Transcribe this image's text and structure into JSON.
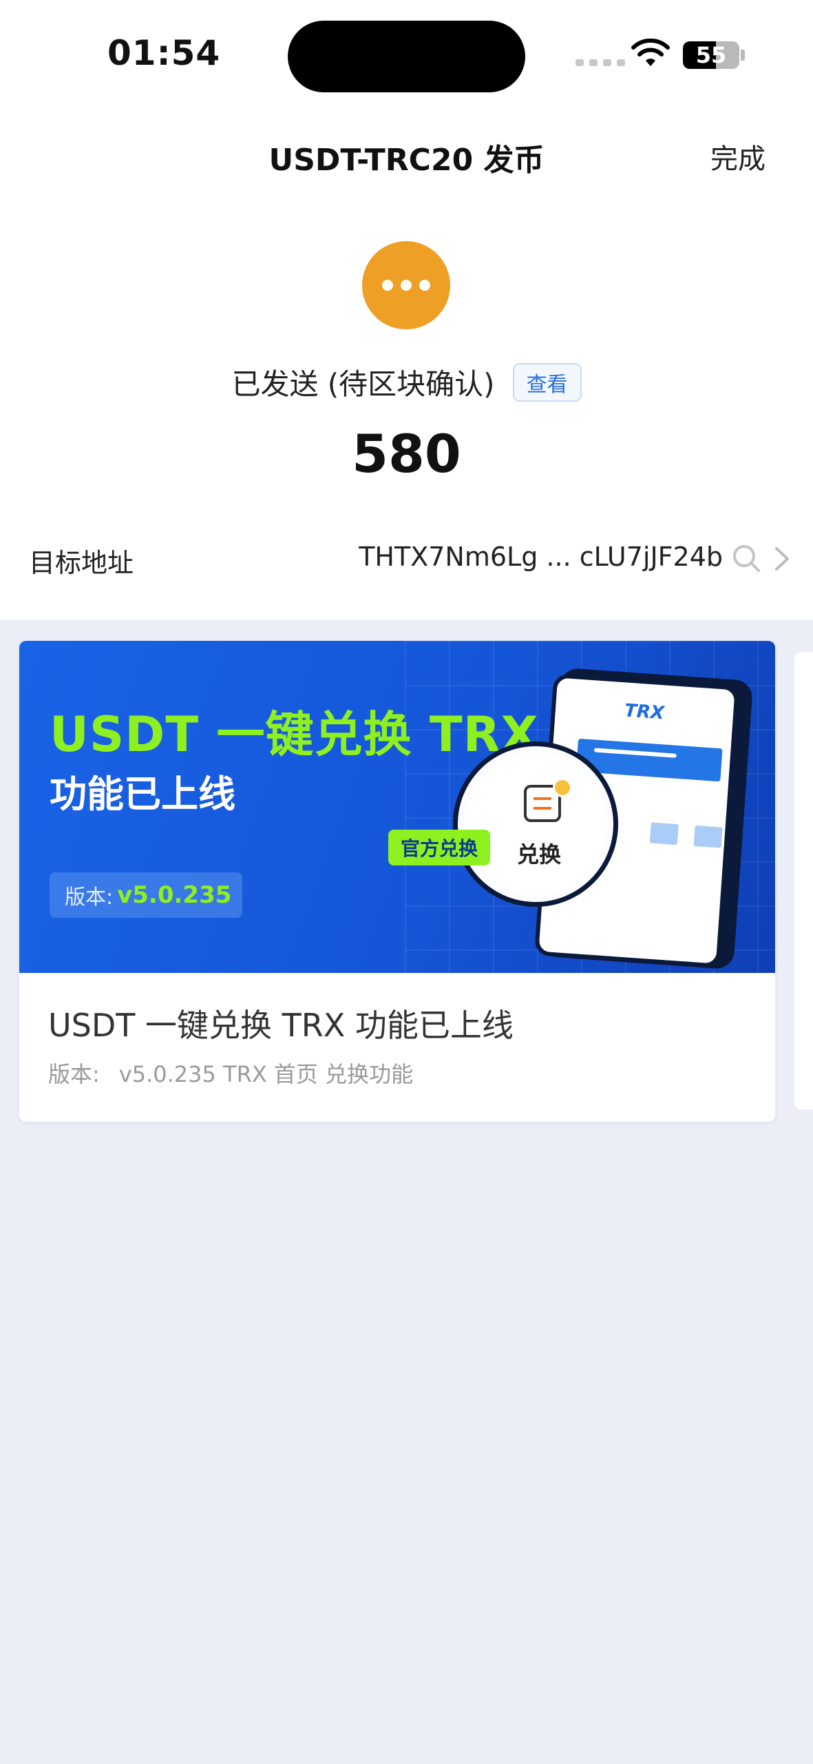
{
  "status_bar": {
    "time": "01:54",
    "battery": "55"
  },
  "nav": {
    "title": "USDT-TRC20 发币",
    "done": "完成"
  },
  "transaction": {
    "status": "已发送 (待区块确认)",
    "view_label": "查看",
    "amount": "580",
    "address_label": "目标地址",
    "address_value": "THTX7Nm6Lg ... cLU7jJF24b"
  },
  "banner": {
    "headline": "USDT 一键兑换 TRX",
    "subheadline": "功能已上线",
    "version_prefix": "版本:",
    "version_number": "v5.0.235",
    "phone_label": "TRX",
    "tag_official": "官方兑换",
    "magnifier_text": "兑换"
  },
  "card": {
    "title": "USDT 一键兑换 TRX 功能已上线",
    "sub_prefix": "版本:",
    "sub_details": "v5.0.235 TRX  首页 兑换功能"
  },
  "colors": {
    "pending": "#ee9f25",
    "accent_blue": "#2a6edb",
    "banner_green": "#8ff020",
    "page_bg": "#ebeef6"
  }
}
